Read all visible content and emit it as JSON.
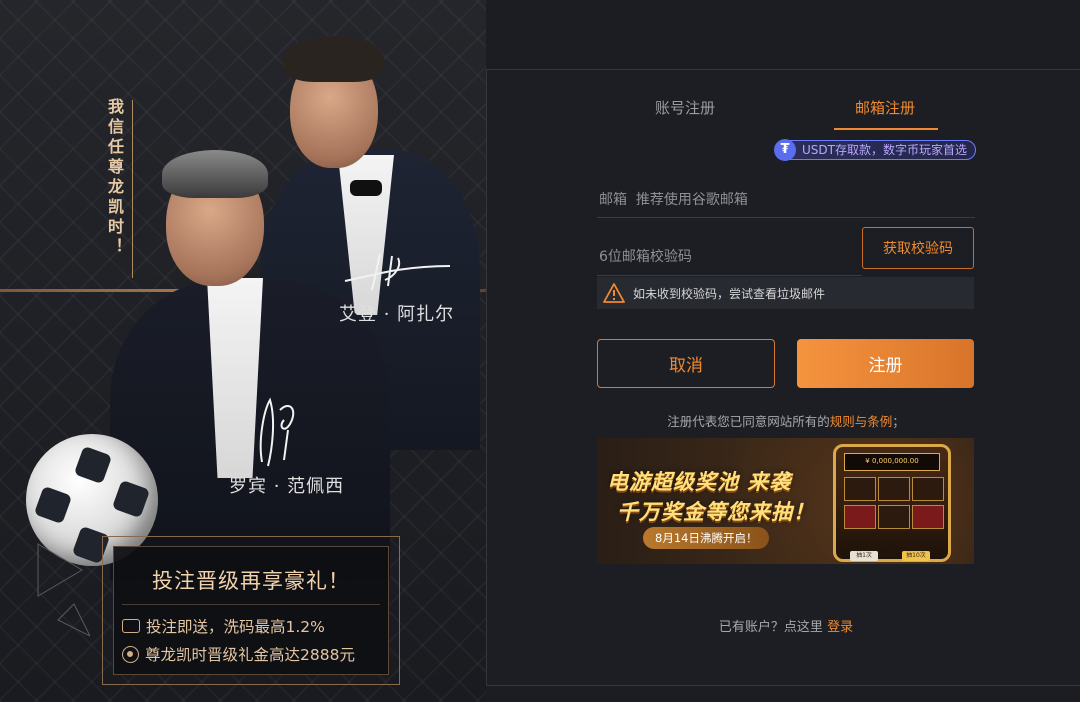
{
  "promo": {
    "slogan": "我信任尊龙凯时！",
    "player1_name": "艾登 · 阿扎尔",
    "player2_name": "罗宾 · 范佩西",
    "box_title": "投注晋级再享豪礼！",
    "line1": "投注即送，洗码最高1.2%",
    "line2": "尊龙凯时晋级礼金高达2888元",
    "line1_icon": "wallet-icon",
    "line2_icon": "coin-icon"
  },
  "form": {
    "tab_account": "账号注册",
    "tab_email": "邮箱注册",
    "active_tab": "email",
    "usdt_badge": "USDT存取款，数字币玩家首选",
    "email_placeholder": "邮箱  推荐使用谷歌邮箱",
    "code_placeholder": "6位邮箱校验码",
    "get_code_label": "获取校验码",
    "hint": "如未收到校验码，尝试查看垃圾邮件",
    "cancel_label": "取消",
    "register_label": "注册",
    "terms_prefix": "注册代表您已同意网站所有的",
    "terms_link": "规则与条例",
    "terms_suffix": "；",
    "have_account": "已有账户？点这里 ",
    "login_link": "登录"
  },
  "banner": {
    "title1": "电游超级奖池 来袭",
    "title2": "千万奖金等您来抽！",
    "date": "8月14日沸腾开启！",
    "screen": "¥ 0,000,000.00",
    "btn1": "抽1次",
    "btn2": "抽10次"
  },
  "colors": {
    "accent": "#f08a2e",
    "gold": "#e6c9a4",
    "background": "#1b1d22"
  }
}
